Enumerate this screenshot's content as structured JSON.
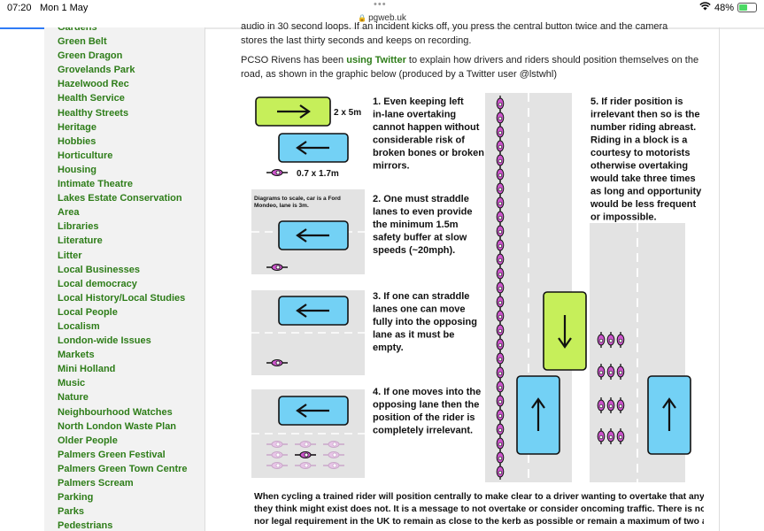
{
  "status": {
    "time": "07:20",
    "date": "Mon 1 May",
    "battery": "48%",
    "battery_level": 0.48,
    "url": "pgweb.uk"
  },
  "sidebar": {
    "items": [
      "Gardens",
      "Green Belt",
      "Green Dragon",
      "Grovelands Park",
      "Hazelwood Rec",
      "Health Service",
      "Healthy Streets",
      "Heritage",
      "Hobbies",
      "Horticulture",
      "Housing",
      "Intimate Theatre",
      "Lakes Estate Conservation",
      "Area",
      "Libraries",
      "Literature",
      "Litter",
      "Local Businesses",
      "Local democracy",
      "Local History/Local Studies",
      "Local People",
      "Localism",
      "London-wide Issues",
      "Markets",
      "Mini Holland",
      "Music",
      "Nature",
      "Neighbourhood Watches",
      "North London Waste Plan",
      "Older People",
      "Palmers Green Festival",
      "Palmers Green Town Centre",
      "Palmers Scream",
      "Parking",
      "Parks",
      "Pedestrians"
    ]
  },
  "article": {
    "cut_line": "audio in 30 second loops. If an incident kicks off, you press the central button twice and the camera",
    "line1": "stores the last thirty seconds and keeps on recording.",
    "para2_before": "PCSO Rivens has been ",
    "para2_link": "using Twitter",
    "para2_after": " to explain how drivers and riders should position themselves on the road, as shown in the graphic below (produced by a Twitter user @lstwhl)"
  },
  "graphic": {
    "car_dims": "2 x 5m",
    "bike_dims": "0.7 x 1.7m",
    "diagram_note": "Diagrams to scale, car is a Ford Mondeo, lane is 3m.",
    "point1": [
      "1. Even keeping left",
      "in-lane overtaking",
      "cannot happen without",
      "considerable risk of",
      "broken bones or broken",
      "mirrors."
    ],
    "point2": [
      "2. One must straddle",
      "lanes to even provide",
      "the minimum 1.5m",
      "safety buffer at slow",
      "speeds (~20mph)."
    ],
    "point3": [
      "3. If one can straddle",
      "lanes one can move",
      "fully into the opposing",
      "lane as it must be",
      "empty."
    ],
    "point4": [
      "4. If one moves into the",
      "opposing lane then the",
      "position of the rider is",
      "completely irrelevant."
    ],
    "point5": [
      "5. If rider position is",
      "irrelevant then so is the",
      "number riding abreast.",
      "Riding in a block is a",
      "courtesy to motorists",
      "otherwise overtaking",
      "would take three times",
      "as long and opportunity",
      "would be less frequent",
      "or impossible."
    ],
    "footer": [
      "When cycling a trained rider will position centrally to make clear to a driver wanting to overtake that any gap",
      "they think might exist does not. It is a message to not overtake or consider oncoming traffic. There is no practical",
      "nor legal requirement in the UK to remain as close to the kerb as possible or remain a maximum of two abreast."
    ],
    "colors": {
      "car_blue": "#73d1f5",
      "car_green": "#c6ef5a",
      "bike_purple": "#cc55cc",
      "road": "#e3e3e3"
    }
  }
}
